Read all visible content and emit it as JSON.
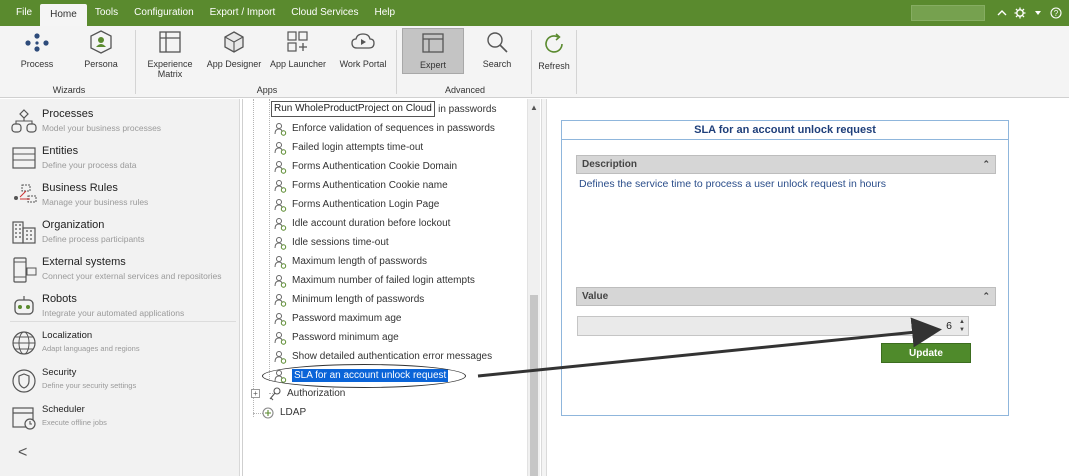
{
  "menubar": {
    "items": [
      "File",
      "Home",
      "Tools",
      "Configuration",
      "Export / Import",
      "Cloud Services",
      "Help"
    ],
    "active": "Home",
    "icons": [
      "chevron-up-icon",
      "gear-icon",
      "chevron-down-icon",
      "help-icon"
    ]
  },
  "ribbon": {
    "buttons": {
      "process": "Process",
      "persona": "Persona",
      "experience_matrix": "Experience Matrix",
      "app_designer": "App Designer",
      "app_launcher": "App Launcher",
      "work_portal": "Work Portal",
      "expert": "Expert",
      "search": "Search",
      "refresh": "Refresh"
    },
    "groups": {
      "wizards": "Wizards",
      "apps": "Apps",
      "advanced": "Advanced"
    }
  },
  "leftnav": {
    "items": [
      {
        "title": "Processes",
        "subtitle": "Model your business processes",
        "icon": "processes-icon"
      },
      {
        "title": "Entities",
        "subtitle": "Define your process data",
        "icon": "entities-icon"
      },
      {
        "title": "Business Rules",
        "subtitle": "Manage your business rules",
        "icon": "business-rules-icon"
      },
      {
        "title": "Organization",
        "subtitle": "Define process participants",
        "icon": "organization-icon"
      },
      {
        "title": "External systems",
        "subtitle": "Connect your external services and repositories",
        "icon": "external-systems-icon"
      },
      {
        "title": "Robots",
        "subtitle": "Integrate your automated applications",
        "icon": "robots-icon"
      },
      {
        "title": "Localization",
        "subtitle": "Adapt languages and regions",
        "icon": "globe-icon"
      },
      {
        "title": "Security",
        "subtitle": "Define your security settings",
        "icon": "shield-icon"
      },
      {
        "title": "Scheduler",
        "subtitle": "Execute offline jobs",
        "icon": "calendar-icon"
      }
    ],
    "collapse_glyph": "<"
  },
  "tree": {
    "tooltip": "Run WholeProductProject on Cloud",
    "first_row_suffix": "rs in passwords",
    "items": [
      "Enforce validation of sequences in passwords",
      "Failed login attempts time-out",
      "Forms Authentication Cookie Domain",
      "Forms Authentication Cookie name",
      "Forms Authentication Login Page",
      "Idle account duration before lockout",
      "Idle sessions time-out",
      "Maximum length of passwords",
      "Maximum number of failed login attempts",
      "Minimum length of passwords",
      "Password maximum age",
      "Password minimum age",
      "Show detailed authentication error messages",
      "SLA for an account unlock request"
    ],
    "selected": "SLA for an account unlock request",
    "authorization": "Authorization",
    "ldap": "LDAP"
  },
  "detail": {
    "title": "SLA for an account unlock request",
    "description_header": "Description",
    "description": "Defines the service time to process a user unlock request in hours",
    "value_header": "Value",
    "value": "6",
    "update_label": "Update"
  },
  "colors": {
    "menubar": "#5a8a2e",
    "selection": "#0a64d8",
    "update_button": "#4f8a2b",
    "card_border": "#8fb6dc"
  }
}
